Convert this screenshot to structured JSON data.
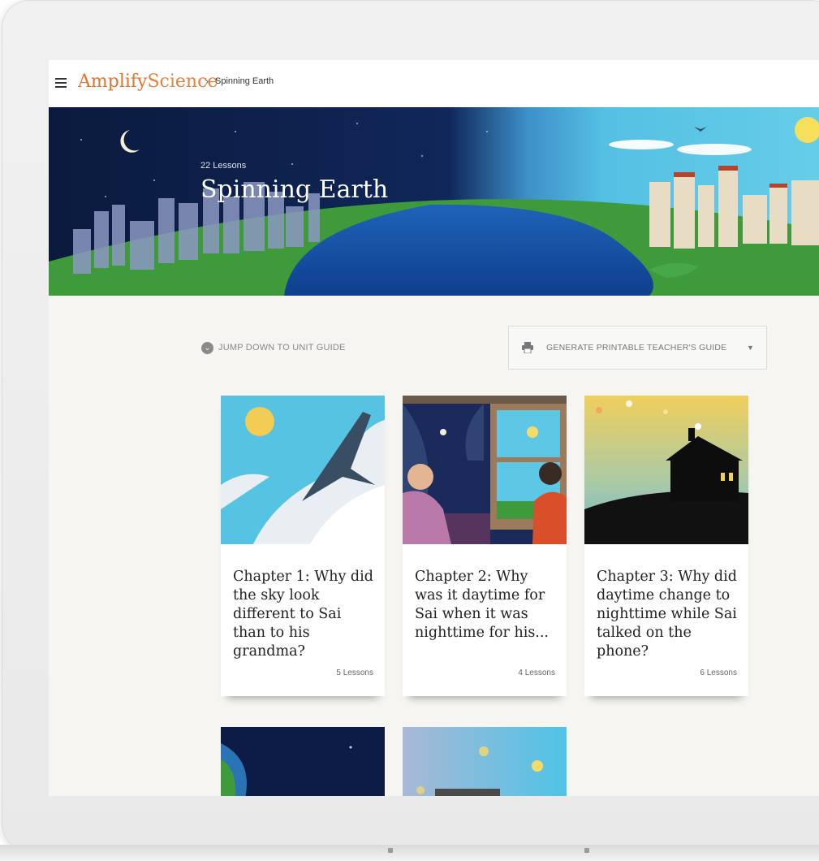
{
  "app": {
    "logo_part1": "Amplify",
    "logo_part2": "Science",
    "breadcrumb_separator": "›",
    "breadcrumb_current": "Spinning Earth"
  },
  "hero": {
    "lesson_count": "22 Lessons",
    "title": "Spinning Earth"
  },
  "actions": {
    "jump_label": "JUMP DOWN TO UNIT GUIDE",
    "generate_label": "GENERATE PRINTABLE TEACHER'S GUIDE",
    "dropdown_glyph": "▼"
  },
  "chapters": [
    {
      "title": "Chapter 1: Why did the sky look different to Sai than to his grandma?",
      "lessons": "5 Lessons"
    },
    {
      "title": "Chapter 2: Why was it daytime for Sai when it was nighttime for his...",
      "lessons": "4 Lessons"
    },
    {
      "title": "Chapter 3: Why did daytime change to nighttime while Sai talked on the phone?",
      "lessons": "6 Lessons"
    }
  ],
  "colors": {
    "brand_orange": "#e0742c",
    "page_bg": "#f6f5f1",
    "night_sky": "#0e1e44",
    "day_sky": "#5fc7e6"
  }
}
